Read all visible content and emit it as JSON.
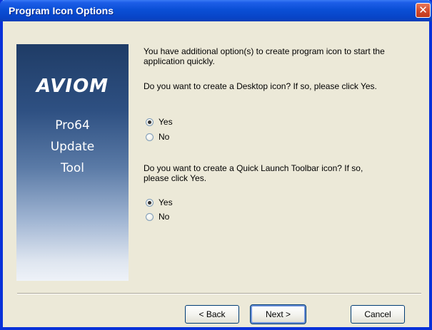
{
  "window": {
    "title": "Program Icon Options",
    "close_symbol": "✕"
  },
  "brand": {
    "logo": "AVIOM",
    "product_lines": [
      "Pro64",
      "Update",
      "Tool"
    ]
  },
  "intro": {
    "line1": "You have additional option(s) to create program icon to start the",
    "line2": "application quickly."
  },
  "desktop_question": "Do you want to create a Desktop icon? If so, please click Yes.",
  "desktop_options": [
    {
      "label": "Yes",
      "checked": true
    },
    {
      "label": "No",
      "checked": false
    }
  ],
  "quicklaunch_question": {
    "line1": "Do you want to create a Quick Launch Toolbar icon? If so,",
    "line2": "please click Yes."
  },
  "quicklaunch_options": [
    {
      "label": "Yes",
      "checked": true
    },
    {
      "label": "No",
      "checked": false
    }
  ],
  "buttons": {
    "back": "< Back",
    "next": "Next >",
    "cancel": "Cancel"
  }
}
